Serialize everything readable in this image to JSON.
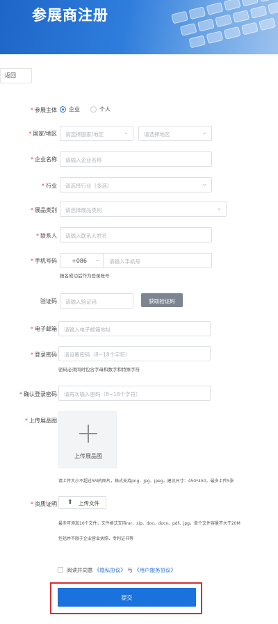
{
  "header": {
    "title": "参展商注册"
  },
  "back": {
    "label": "返回"
  },
  "form": {
    "subject": {
      "label": "参展主体",
      "options": [
        "企业",
        "个人"
      ],
      "selected": "企业"
    },
    "region": {
      "label": "国家/地区",
      "country_placeholder": "请选择国家/地区",
      "region_placeholder": "请选择地区"
    },
    "company": {
      "label": "企业名称",
      "placeholder": "请输入企业名称"
    },
    "industry": {
      "label": "行业",
      "placeholder": "请选择行业（多选）"
    },
    "category": {
      "label": "展品类别",
      "placeholder": "请选择展品类别"
    },
    "contact": {
      "label": "联系人",
      "placeholder": "请输入联系人姓名"
    },
    "phone": {
      "label": "手机号码",
      "code": "+086",
      "placeholder": "请输入手机号",
      "hint": "报名成功后作为登录账号"
    },
    "verify": {
      "label": "验证码",
      "placeholder": "请输入验证码",
      "button": "获取验证码"
    },
    "email": {
      "label": "电子邮箱",
      "placeholder": "请输入电子邮箱地址"
    },
    "password": {
      "label": "登录密码",
      "placeholder": "请设置密码（8~18个字符）",
      "hint": "密码必须同时包含字母和数字和特殊字符"
    },
    "confirm": {
      "label": "确认登录密码",
      "placeholder": "请再次输入密码（8~18个字符）"
    },
    "image": {
      "label": "上传展品图",
      "button": "上传展品图",
      "hint": "请上传大小不超过5M的图片，格式支持png、jpg、jpeg，建议尺寸：450*450，最多上传5张"
    },
    "proof": {
      "label": "资质证明",
      "button": "上传文件",
      "hint1": "最多可添加10个文件，文件格式支持rar、zip、doc、docx、pdf、jpg，单个文件容量不大于20M",
      "hint2": "包括并不限于企业营业执照、专利证书等"
    },
    "agree": {
      "prefix": "阅读并同意",
      "privacy": "《隐私协议》",
      "and": "与",
      "user": "《用户服务协议》"
    },
    "submit": {
      "label": "提交"
    }
  },
  "colors": {
    "accent": "#1a72dc",
    "required": "#e23b3b",
    "highlight_frame": "#d62f2f"
  },
  "icons": {
    "upload": "upload-arrow-icon",
    "plus": "plus-icon",
    "dropdown": "chevron-down-icon"
  }
}
